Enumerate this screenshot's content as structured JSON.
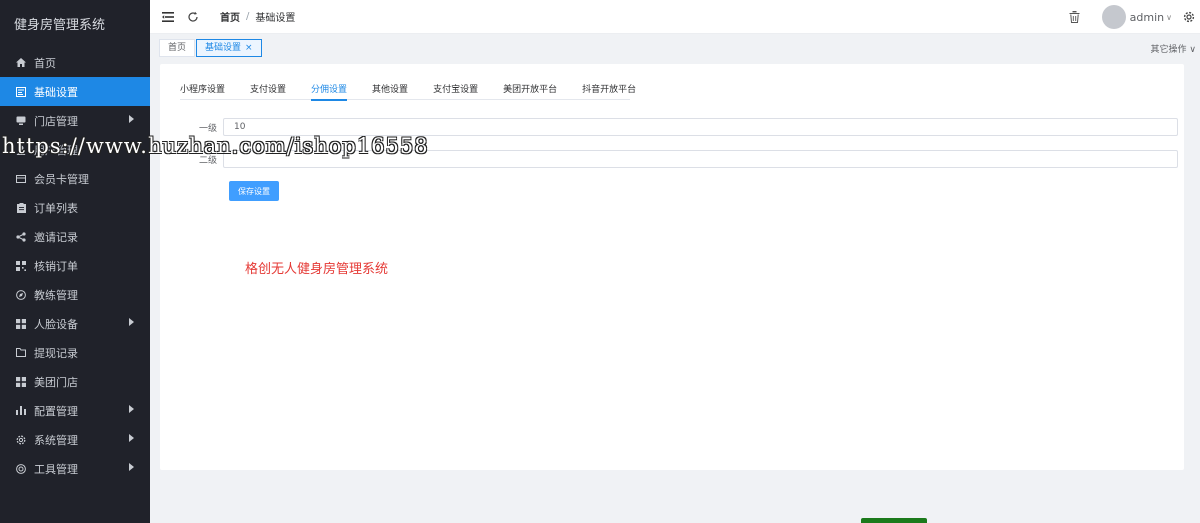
{
  "app": {
    "title": "健身房管理系统"
  },
  "sidebar": {
    "items": [
      {
        "label": "首页",
        "icon": "home-icon",
        "active": false,
        "has_children": false
      },
      {
        "label": "基础设置",
        "icon": "settings-doc-icon",
        "active": true,
        "has_children": false
      },
      {
        "label": "门店管理",
        "icon": "store-icon",
        "active": false,
        "has_children": true
      },
      {
        "label": "用户管理",
        "icon": "user-icon",
        "active": false,
        "has_children": false
      },
      {
        "label": "会员卡管理",
        "icon": "card-icon",
        "active": false,
        "has_children": false
      },
      {
        "label": "订单列表",
        "icon": "clipboard-icon",
        "active": false,
        "has_children": false
      },
      {
        "label": "邀请记录",
        "icon": "share-icon",
        "active": false,
        "has_children": false
      },
      {
        "label": "核销订单",
        "icon": "grid-icon",
        "active": false,
        "has_children": false
      },
      {
        "label": "教练管理",
        "icon": "compass-icon",
        "active": false,
        "has_children": false
      },
      {
        "label": "人脸设备",
        "icon": "apps-icon",
        "active": false,
        "has_children": true
      },
      {
        "label": "提现记录",
        "icon": "folder-icon",
        "active": false,
        "has_children": false
      },
      {
        "label": "美团门店",
        "icon": "apps-icon",
        "active": false,
        "has_children": false
      },
      {
        "label": "配置管理",
        "icon": "bar-chart-icon",
        "active": false,
        "has_children": true
      },
      {
        "label": "系统管理",
        "icon": "gear-icon",
        "active": false,
        "has_children": true
      },
      {
        "label": "工具管理",
        "icon": "tool-icon",
        "active": false,
        "has_children": true
      }
    ]
  },
  "header": {
    "breadcrumb_home": "首页",
    "breadcrumb_sep": "/",
    "breadcrumb_current": "基础设置",
    "username": "admin",
    "caret": "∨"
  },
  "tabs": {
    "home": "首页",
    "active": "基础设置",
    "close": "×",
    "other_ops": "其它操作 ∨"
  },
  "settings": {
    "subtabs": [
      "小程序设置",
      "支付设置",
      "分佣设置",
      "其他设置",
      "支付宝设置",
      "美团开放平台",
      "抖音开放平台"
    ],
    "active_subtab": 2,
    "level1_label": "一级",
    "level1_value": "10",
    "level2_label": "二级",
    "level2_value": "",
    "save_label": "保存设置"
  },
  "overlay": {
    "red_text": "格创无人健身房管理系统",
    "url_text": "https://www.huzhan.com/ishop16558"
  },
  "colors": {
    "sidebar_bg": "#20222a",
    "accent": "#1e88e5",
    "button": "#409eff",
    "red": "#e53935"
  }
}
